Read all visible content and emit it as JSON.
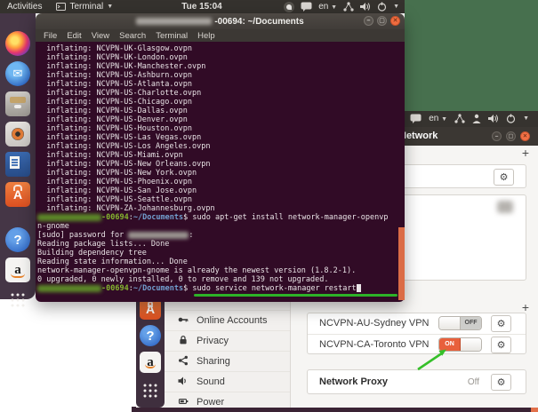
{
  "colors": {
    "accent_orange": "#e2714b",
    "toggle_on": "#e8603c",
    "arrow_green": "#2db228",
    "prompt_green": "#85b52f",
    "path_blue": "#729fcf",
    "wallpaper_green": "#47704e"
  },
  "topbar": {
    "activities": "Activities",
    "app_menu": "Terminal",
    "clock": "Tue 15:04",
    "lang": "en"
  },
  "topbar_bg": {
    "lang": "en"
  },
  "dock_fg": [
    "firefox",
    "thunderbird",
    "files",
    "rhythmbox",
    "writer",
    "software",
    "help",
    "amazon",
    "app-grid"
  ],
  "dock_bg": [
    "software",
    "help",
    "amazon",
    "app-grid"
  ],
  "terminal": {
    "title_suffix": "-00694: ~/Documents",
    "menu": [
      "File",
      "Edit",
      "View",
      "Search",
      "Terminal",
      "Help"
    ],
    "prompt": {
      "host_suffix": "-00694",
      "sep": ":",
      "path": "~/Documents",
      "dollar": "$ "
    },
    "lines": [
      [
        {
          "t": "  inflating: NCVPN-UK-Glasgow.ovpn"
        }
      ],
      [
        {
          "t": "  inflating: NCVPN-UK-London.ovpn"
        }
      ],
      [
        {
          "t": "  inflating: NCVPN-UK-Manchester.ovpn"
        }
      ],
      [
        {
          "t": "  inflating: NCVPN-US-Ashburn.ovpn"
        }
      ],
      [
        {
          "t": "  inflating: NCVPN-US-Atlanta.ovpn"
        }
      ],
      [
        {
          "t": "  inflating: NCVPN-US-Charlotte.ovpn"
        }
      ],
      [
        {
          "t": "  inflating: NCVPN-US-Chicago.ovpn"
        }
      ],
      [
        {
          "t": "  inflating: NCVPN-US-Dallas.ovpn"
        }
      ],
      [
        {
          "t": "  inflating: NCVPN-US-Denver.ovpn"
        }
      ],
      [
        {
          "t": "  inflating: NCVPN-US-Houston.ovpn"
        }
      ],
      [
        {
          "t": "  inflating: NCVPN-US-Las Vegas.ovpn"
        }
      ],
      [
        {
          "t": "  inflating: NCVPN-US-Los Angeles.ovpn"
        }
      ],
      [
        {
          "t": "  inflating: NCVPN-US-Miami.ovpn"
        }
      ],
      [
        {
          "t": "  inflating: NCVPN-US-New Orleans.ovpn"
        }
      ],
      [
        {
          "t": "  inflating: NCVPN-US-New York.ovpn"
        }
      ],
      [
        {
          "t": "  inflating: NCVPN-US-Phoenix.ovpn"
        }
      ],
      [
        {
          "t": "  inflating: NCVPN-US-San Jose.ovpn"
        }
      ],
      [
        {
          "t": "  inflating: NCVPN-US-Seattle.ovpn"
        }
      ],
      [
        {
          "t": "  inflating: NCVPN-ZA-Johannesburg.ovpn"
        }
      ],
      [
        {
          "c": "blob"
        },
        {
          "t": "-00694",
          "c": "green"
        },
        {
          "t": ":"
        },
        {
          "t": "~/Documents",
          "c": "blue"
        },
        {
          "t": "$ "
        },
        {
          "t": "sudo apt-get install network-manager-openvp"
        }
      ],
      [
        {
          "t": "n-gnome"
        }
      ],
      [
        {
          "t": "[sudo] password for "
        },
        {
          "c": "blobgray"
        },
        {
          "t": ":"
        }
      ],
      [
        {
          "t": "Reading package lists... Done"
        }
      ],
      [
        {
          "t": "Building dependency tree"
        }
      ],
      [
        {
          "t": "Reading state information... Done"
        }
      ],
      [
        {
          "t": "network-manager-openvpn-gnome is already the newest version (1.8.2-1)."
        }
      ],
      [
        {
          "t": "0 upgraded, 0 newly installed, 0 to remove and 139 not upgraded."
        }
      ],
      [
        {
          "c": "blob"
        },
        {
          "t": "-00694",
          "c": "green"
        },
        {
          "t": ":"
        },
        {
          "t": "~/Documents",
          "c": "blue"
        },
        {
          "t": "$ "
        },
        {
          "t": "sudo service network-manager restart"
        },
        {
          "c": "cursor"
        }
      ]
    ]
  },
  "settings": {
    "title": "Network",
    "window_buttons": [
      "minimize",
      "maximize",
      "close"
    ],
    "add_wired": "+",
    "add_vpn": "+",
    "sidebar": [
      {
        "icon": "online-accounts-icon",
        "label": "Online Accounts"
      },
      {
        "icon": "privacy-icon",
        "label": "Privacy"
      },
      {
        "icon": "sharing-icon",
        "label": "Sharing"
      },
      {
        "icon": "sound-icon",
        "label": "Sound"
      },
      {
        "icon": "power-icon",
        "label": "Power"
      }
    ],
    "vpn_rows": [
      {
        "name": "NCVPN-AU-Sydney VPN",
        "state": "OFF"
      },
      {
        "name": "NCVPN-CA-Toronto VPN",
        "state": "ON"
      }
    ],
    "proxy": {
      "label": "Network Proxy",
      "state": "Off"
    }
  }
}
